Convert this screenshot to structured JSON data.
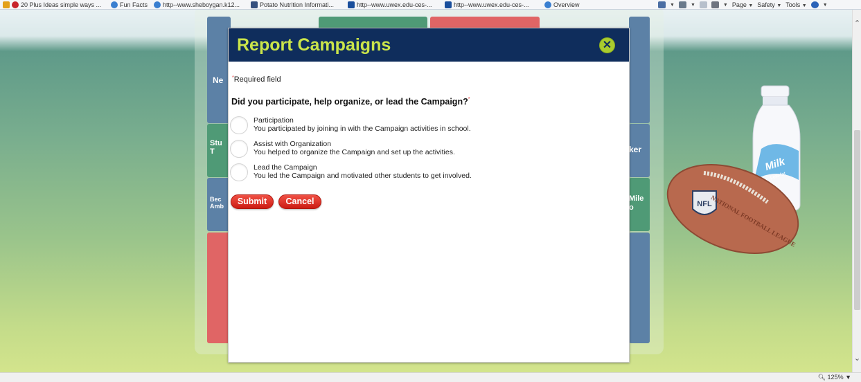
{
  "favorites": [
    {
      "label": "20 Plus Ideas simple ways ...",
      "icon": "pinterest-icon"
    },
    {
      "label": "Fun Facts",
      "icon": "ie-page-icon"
    },
    {
      "label": "http--www.sheboygan.k12...",
      "icon": "ie-page-icon"
    },
    {
      "label": "Potato Nutrition Informati...",
      "icon": "page-icon"
    },
    {
      "label": "http--www.uwex.edu-ces-...",
      "icon": "uwex-icon"
    },
    {
      "label": "http--www.uwex.edu-ces-...",
      "icon": "uwex-icon"
    },
    {
      "label": "Overview",
      "icon": "ie-page-icon"
    }
  ],
  "command_bar": {
    "page": "Page",
    "safety": "Safety",
    "tools": "Tools"
  },
  "tiles_behind": {
    "left_top": "Ne",
    "left_mid": "Stu\nT",
    "left_low": "Bec\nAmb",
    "right_mid": "ker",
    "right_low": "Mile\no"
  },
  "modal": {
    "title": "Report Campaigns",
    "close_label": "✕",
    "required_note": "Required field",
    "required_marker": "*",
    "question": "Did you participate, help organize, or lead the Campaign?",
    "options": [
      {
        "title": "Participation",
        "description": "You participated by joining in with the Campaign activities in school."
      },
      {
        "title": "Assist with Organization",
        "description": "You helped to organize the Campaign and set up the activities."
      },
      {
        "title": "Lead the Campaign",
        "description": "You led the Campaign and motivated other students to get involved."
      }
    ],
    "submit_label": "Submit",
    "cancel_label": "Cancel"
  },
  "decor": {
    "milk_text": "Milk",
    "milk_sub": "Low-fat",
    "nfl_shield": "NFL",
    "football_text": "NATIONAL FOOTBALL LEAGUE"
  },
  "status_bar": {
    "zoom": "125%"
  },
  "colors": {
    "header_navy": "#0f2d5c",
    "title_lime": "#cbe54a",
    "close_green": "#a9cc2e",
    "button_red": "#e03028",
    "tile_blue": "#5c81a6",
    "tile_green": "#4f9a76",
    "tile_red": "#e06565"
  }
}
